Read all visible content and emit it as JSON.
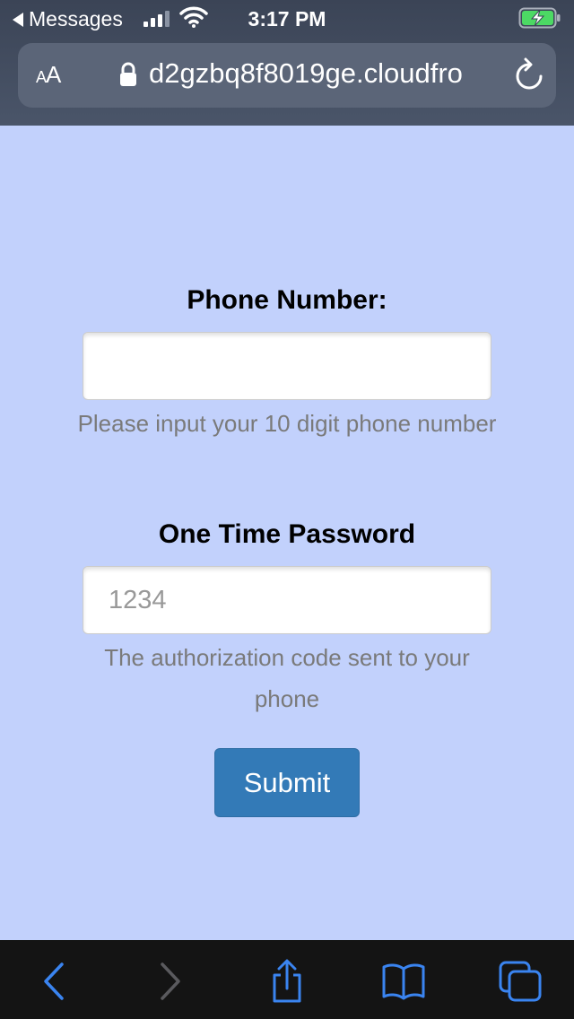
{
  "status_bar": {
    "back_app": "Messages",
    "time": "3:17 PM"
  },
  "browser": {
    "text_size_label_small": "A",
    "text_size_label_large": "A",
    "url": "d2gzbq8f8019ge.cloudfro",
    "icons": [
      "lock-icon",
      "reload-icon",
      "back-icon",
      "forward-icon",
      "share-icon",
      "bookmarks-icon",
      "tabs-icon"
    ]
  },
  "form": {
    "phone_label": "Phone Number:",
    "phone_value": "",
    "phone_placeholder": "",
    "phone_help": "Please input your 10 digit phone number",
    "otp_label": "One Time Password",
    "otp_value": "",
    "otp_placeholder": "1234",
    "otp_help": "The authorization code sent to your phone",
    "submit_label": "Submit"
  },
  "colors": {
    "page_background": "#c2d1fc",
    "submit_button": "#337ab7",
    "toolbar_icons": "#3a84f0"
  }
}
